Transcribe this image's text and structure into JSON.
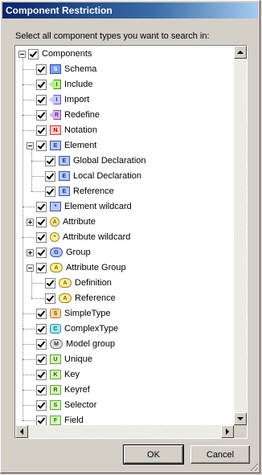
{
  "dialog": {
    "title": "Component Restriction",
    "instruction": "Select all component types you want to search in:",
    "ok_label": "OK",
    "cancel_label": "Cancel"
  },
  "tree": {
    "root": {
      "label": "Components",
      "checked": true,
      "expanded": true
    },
    "items": [
      {
        "label": "Schema",
        "icon": "schema-icon",
        "glyph": "S",
        "checked": true
      },
      {
        "label": "Include",
        "icon": "include-icon",
        "glyph": "I",
        "checked": true
      },
      {
        "label": "Import",
        "icon": "import-icon",
        "glyph": "I",
        "checked": true
      },
      {
        "label": "Redefine",
        "icon": "redefine-icon",
        "glyph": "R",
        "checked": true
      },
      {
        "label": "Notation",
        "icon": "notation-icon",
        "glyph": "N",
        "checked": true
      },
      {
        "label": "Element",
        "icon": "element-icon",
        "glyph": "E",
        "checked": true,
        "expanded": true,
        "children": [
          {
            "label": "Global Declaration",
            "icon": "element-icon",
            "glyph": "E",
            "checked": true
          },
          {
            "label": "Local Declaration",
            "icon": "element-icon",
            "glyph": "E",
            "checked": true
          },
          {
            "label": "Reference",
            "icon": "element-icon",
            "glyph": "E",
            "checked": true
          }
        ]
      },
      {
        "label": "Element wildcard",
        "icon": "element-wildcard-icon",
        "glyph": "*",
        "checked": true
      },
      {
        "label": "Attribute",
        "icon": "attribute-icon",
        "glyph": "A",
        "checked": true,
        "collapsed": true
      },
      {
        "label": "Attribute wildcard",
        "icon": "attribute-wildcard-icon",
        "glyph": "*",
        "checked": true
      },
      {
        "label": "Group",
        "icon": "group-icon",
        "glyph": "G",
        "checked": true,
        "collapsed": true
      },
      {
        "label": "Attribute Group",
        "icon": "attribute-group-icon",
        "glyph": "A",
        "checked": true,
        "expanded": true,
        "children": [
          {
            "label": "Definition",
            "icon": "attribute-group-icon",
            "glyph": "A",
            "checked": true
          },
          {
            "label": "Reference",
            "icon": "attribute-group-icon",
            "glyph": "A",
            "checked": true
          }
        ]
      },
      {
        "label": "SimpleType",
        "icon": "simple-type-icon",
        "glyph": "S",
        "checked": true
      },
      {
        "label": "ComplexType",
        "icon": "complex-type-icon",
        "glyph": "C",
        "checked": true
      },
      {
        "label": "Model group",
        "icon": "model-group-icon",
        "glyph": "M",
        "checked": true
      },
      {
        "label": "Unique",
        "icon": "unique-icon",
        "glyph": "U",
        "checked": true
      },
      {
        "label": "Key",
        "icon": "key-icon",
        "glyph": "K",
        "checked": true
      },
      {
        "label": "Keyref",
        "icon": "keyref-icon",
        "glyph": "R",
        "checked": true
      },
      {
        "label": "Selector",
        "icon": "selector-icon",
        "glyph": "S",
        "checked": true
      },
      {
        "label": "Field",
        "icon": "field-icon",
        "glyph": "F",
        "checked": true
      }
    ]
  }
}
